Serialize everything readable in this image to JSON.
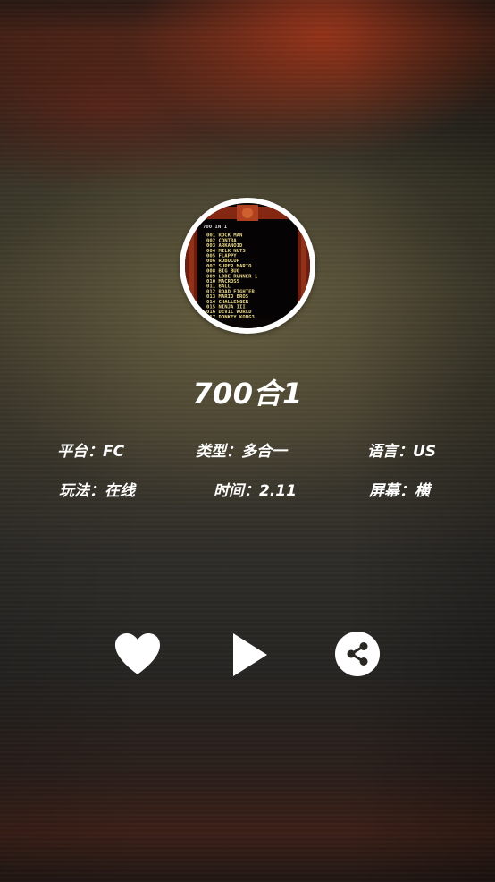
{
  "game": {
    "title": "700合1",
    "cover_lines": [
      "700 IN 1",
      "001 ROCK MAN",
      "002 CONTRA",
      "003 ARKANOID",
      "004 MILK NUTS",
      "005 FLAPPY",
      "006 ROBOCOP",
      "007 SUPER MARIO",
      "008 BIG BUG",
      "009 LODE RUNNER 1",
      "010 MACROSS",
      "011 BALL",
      "012 ROAD FIGHTER",
      "013 MARIO BROS",
      "014 CHALLENGER",
      "015 NINJA III",
      "016 DEVIL WORLD",
      "017 DONKEY KONG3"
    ]
  },
  "info": {
    "platform": "平台：FC",
    "type": "类型：多合一",
    "language": "语言：US",
    "mode": "玩法：在线",
    "time": "时间：2.11",
    "screen": "屏幕：横"
  },
  "actions": {
    "favorite_icon": "heart-icon",
    "play_icon": "play-icon",
    "share_icon": "share-icon"
  },
  "colors": {
    "text": "#ffffff",
    "cover_border": "#ffffff",
    "cover_text": "#e8d88a",
    "cover_frame": "#8a2a14"
  }
}
